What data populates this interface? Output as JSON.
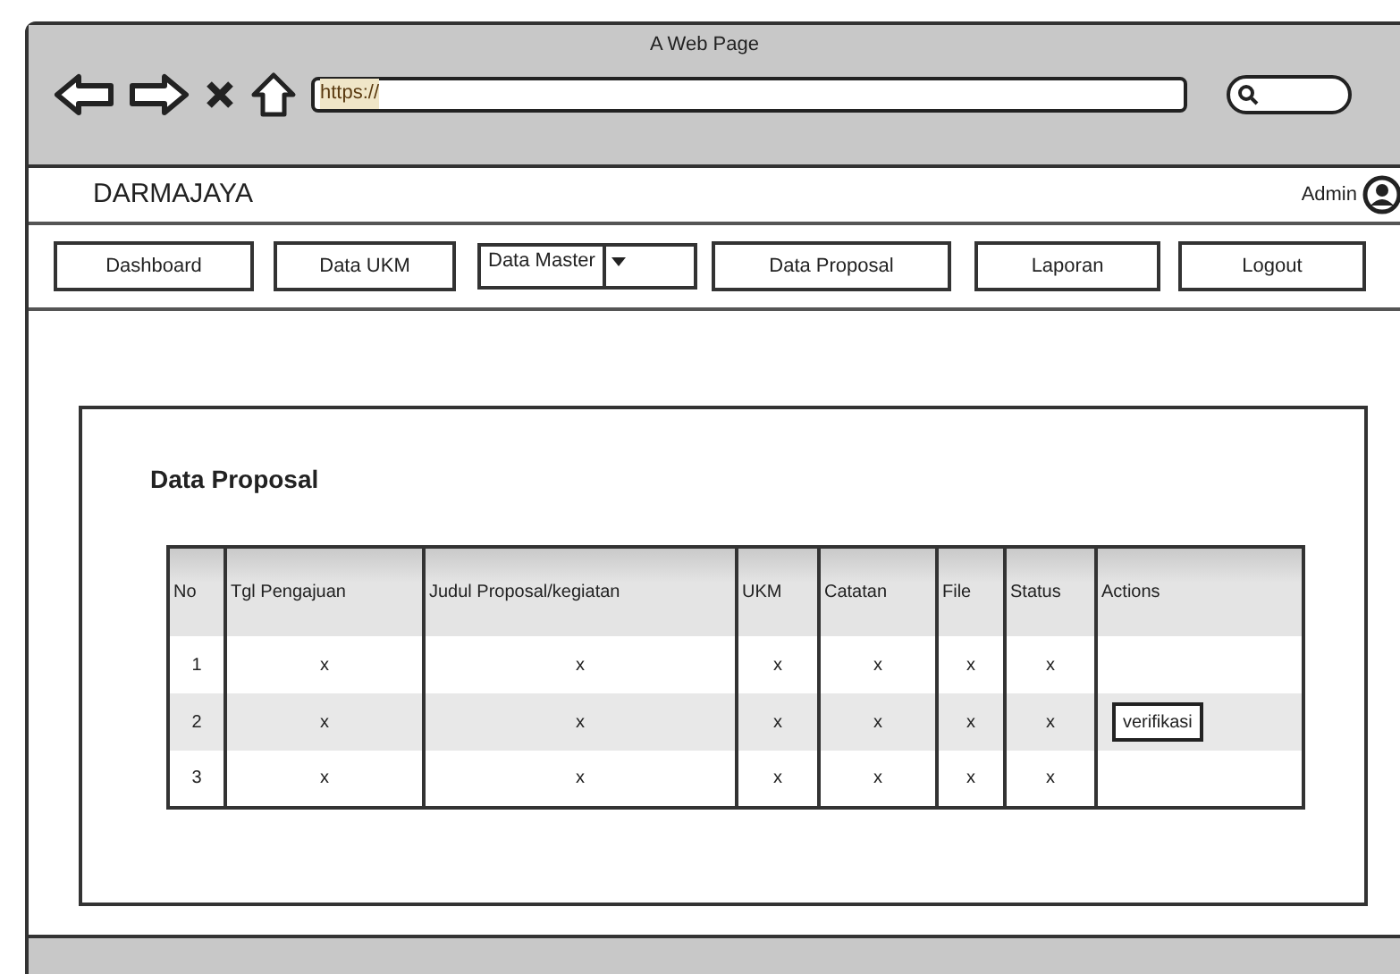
{
  "window": {
    "title": "A Web Page",
    "url": "https://"
  },
  "header": {
    "brand": "DARMAJAYA",
    "user": "Admin"
  },
  "nav": [
    {
      "label": "Dashboard",
      "kind": "button"
    },
    {
      "label": "Data UKM",
      "kind": "button"
    },
    {
      "label": "Data Master",
      "kind": "dropdown"
    },
    {
      "label": "Data Proposal",
      "kind": "button"
    },
    {
      "label": "Laporan",
      "kind": "button"
    },
    {
      "label": "Logout",
      "kind": "button"
    }
  ],
  "section_title": "Data Proposal",
  "table": {
    "columns": [
      "No",
      "Tgl Pengajuan",
      "Judul Proposal/kegiatan",
      "UKM",
      "Catatan",
      "File",
      "Status",
      "Actions"
    ],
    "rows": [
      {
        "cells": [
          "1",
          "x",
          "x",
          "x",
          "x",
          "x",
          "x"
        ]
      },
      {
        "cells": [
          "2",
          "x",
          "x",
          "x",
          "x",
          "x",
          "x"
        ],
        "action": "verifikasi"
      },
      {
        "cells": [
          "3",
          "x",
          "x",
          "x",
          "x",
          "x",
          "x"
        ]
      }
    ]
  }
}
